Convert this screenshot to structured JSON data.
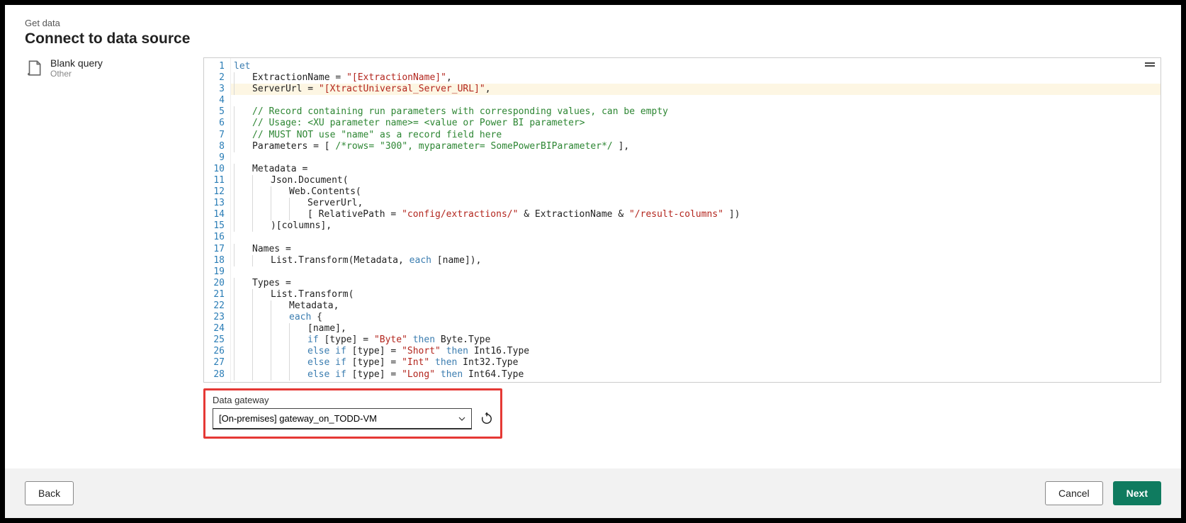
{
  "header": {
    "breadcrumb": "Get data",
    "title": "Connect to data source"
  },
  "side": {
    "title": "Blank query",
    "subtitle": "Other"
  },
  "code": {
    "lines": [
      [
        [
          "kw",
          "let"
        ]
      ],
      [
        [
          "blk",
          "    ExtractionName = "
        ],
        [
          "str",
          "\"[ExtractionName]\""
        ],
        [
          "blk",
          ","
        ]
      ],
      [
        [
          "blk",
          "    ServerUrl = "
        ],
        [
          "str",
          "\"[XtractUniversal_Server_URL]\""
        ],
        [
          "blk",
          ","
        ]
      ],
      [
        [
          "blk",
          ""
        ]
      ],
      [
        [
          "blk",
          "    "
        ],
        [
          "gr",
          "// Record containing run parameters with corresponding values, can be empty"
        ]
      ],
      [
        [
          "blk",
          "    "
        ],
        [
          "gr",
          "// Usage: <XU parameter name>= <value or Power BI parameter>"
        ]
      ],
      [
        [
          "blk",
          "    "
        ],
        [
          "gr",
          "// MUST NOT use \"name\" as a record field here"
        ]
      ],
      [
        [
          "blk",
          "    Parameters = [ "
        ],
        [
          "gr",
          "/*rows= \"300\", myparameter= SomePowerBIParameter*/"
        ],
        [
          "blk",
          " ],"
        ]
      ],
      [
        [
          "blk",
          ""
        ]
      ],
      [
        [
          "blk",
          "    Metadata ="
        ]
      ],
      [
        [
          "blk",
          "        Json.Document("
        ]
      ],
      [
        [
          "blk",
          "            Web.Contents("
        ]
      ],
      [
        [
          "blk",
          "                ServerUrl,"
        ]
      ],
      [
        [
          "blk",
          "                [ RelativePath = "
        ],
        [
          "str",
          "\"config/extractions/\""
        ],
        [
          "blk",
          " & ExtractionName & "
        ],
        [
          "str",
          "\"/result-columns\""
        ],
        [
          "blk",
          " ])"
        ]
      ],
      [
        [
          "blk",
          "        )[columns],"
        ]
      ],
      [
        [
          "blk",
          ""
        ]
      ],
      [
        [
          "blk",
          "    Names ="
        ]
      ],
      [
        [
          "blk",
          "        List.Transform(Metadata, "
        ],
        [
          "kw",
          "each"
        ],
        [
          "blk",
          " [name]),"
        ]
      ],
      [
        [
          "blk",
          ""
        ]
      ],
      [
        [
          "blk",
          "    Types ="
        ]
      ],
      [
        [
          "blk",
          "        List.Transform("
        ]
      ],
      [
        [
          "blk",
          "            Metadata,"
        ]
      ],
      [
        [
          "blk",
          "            "
        ],
        [
          "kw",
          "each"
        ],
        [
          "blk",
          " {"
        ]
      ],
      [
        [
          "blk",
          "                [name],"
        ]
      ],
      [
        [
          "blk",
          "                "
        ],
        [
          "kw",
          "if"
        ],
        [
          "blk",
          " [type] = "
        ],
        [
          "str",
          "\"Byte\""
        ],
        [
          "blk",
          " "
        ],
        [
          "kw",
          "then"
        ],
        [
          "blk",
          " Byte.Type"
        ]
      ],
      [
        [
          "blk",
          "                "
        ],
        [
          "kw",
          "else if"
        ],
        [
          "blk",
          " [type] = "
        ],
        [
          "str",
          "\"Short\""
        ],
        [
          "blk",
          " "
        ],
        [
          "kw",
          "then"
        ],
        [
          "blk",
          " Int16.Type"
        ]
      ],
      [
        [
          "blk",
          "                "
        ],
        [
          "kw",
          "else if"
        ],
        [
          "blk",
          " [type] = "
        ],
        [
          "str",
          "\"Int\""
        ],
        [
          "blk",
          " "
        ],
        [
          "kw",
          "then"
        ],
        [
          "blk",
          " Int32.Type"
        ]
      ],
      [
        [
          "blk",
          "                "
        ],
        [
          "kw",
          "else if"
        ],
        [
          "blk",
          " [type] = "
        ],
        [
          "str",
          "\"Long\""
        ],
        [
          "blk",
          " "
        ],
        [
          "kw",
          "then"
        ],
        [
          "blk",
          " Int64.Type"
        ]
      ]
    ]
  },
  "gateway": {
    "label": "Data gateway",
    "value": "[On-premises] gateway_on_TODD-VM"
  },
  "footer": {
    "back": "Back",
    "cancel": "Cancel",
    "next": "Next"
  }
}
